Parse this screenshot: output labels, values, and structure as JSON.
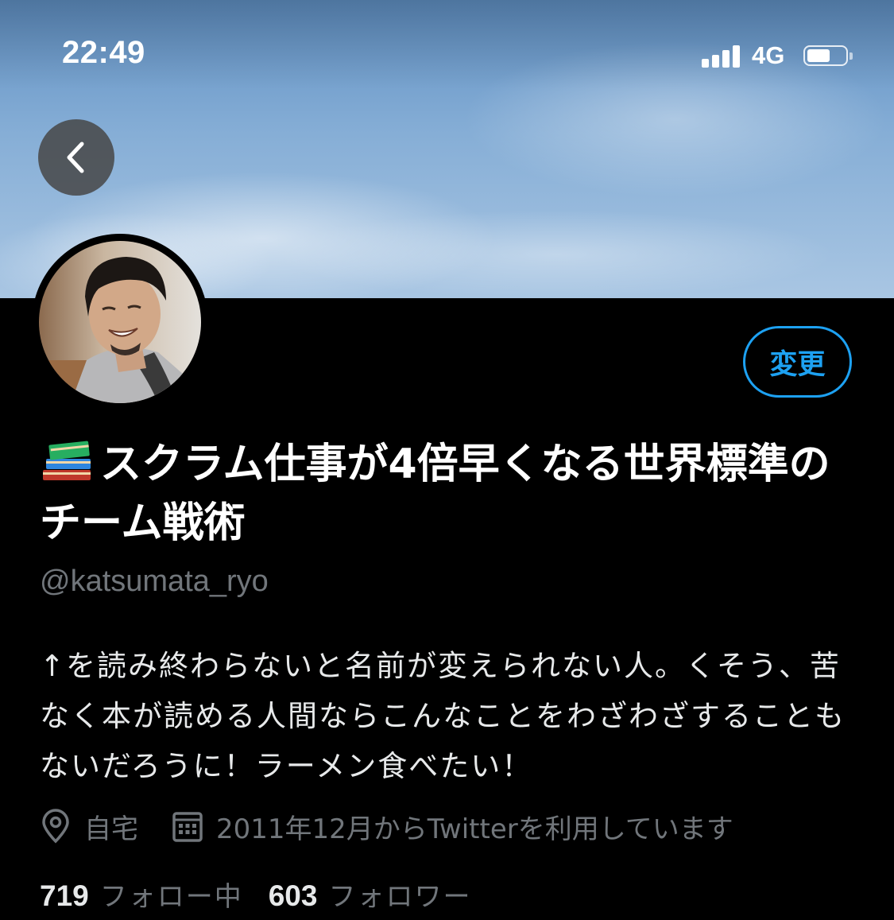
{
  "status_bar": {
    "time": "22:49",
    "network": "4G",
    "signal_bars": 4,
    "battery_level": 0.6
  },
  "header": {
    "back_icon": "chevron-left-icon",
    "edit_label": "変更"
  },
  "profile": {
    "name_emoji": "books-icon",
    "display_name": "スクラム仕事が4倍早くなる世界標準のチーム戦術",
    "handle": "@katsumata_ryo",
    "bio": "↑を読み終わらないと名前が変えられない人。くそう、苦なく本が読める人間ならこんなことをわざわざすることもないだろうに！ラーメン食べたい！",
    "location": "自宅",
    "joined": "2011年12月からTwitterを利用しています",
    "following_count": "719",
    "following_label": "フォロー中",
    "followers_count": "603",
    "followers_label": "フォロワー"
  },
  "colors": {
    "accent": "#1da1f2",
    "background": "#000000",
    "secondary_text": "#71767b"
  }
}
